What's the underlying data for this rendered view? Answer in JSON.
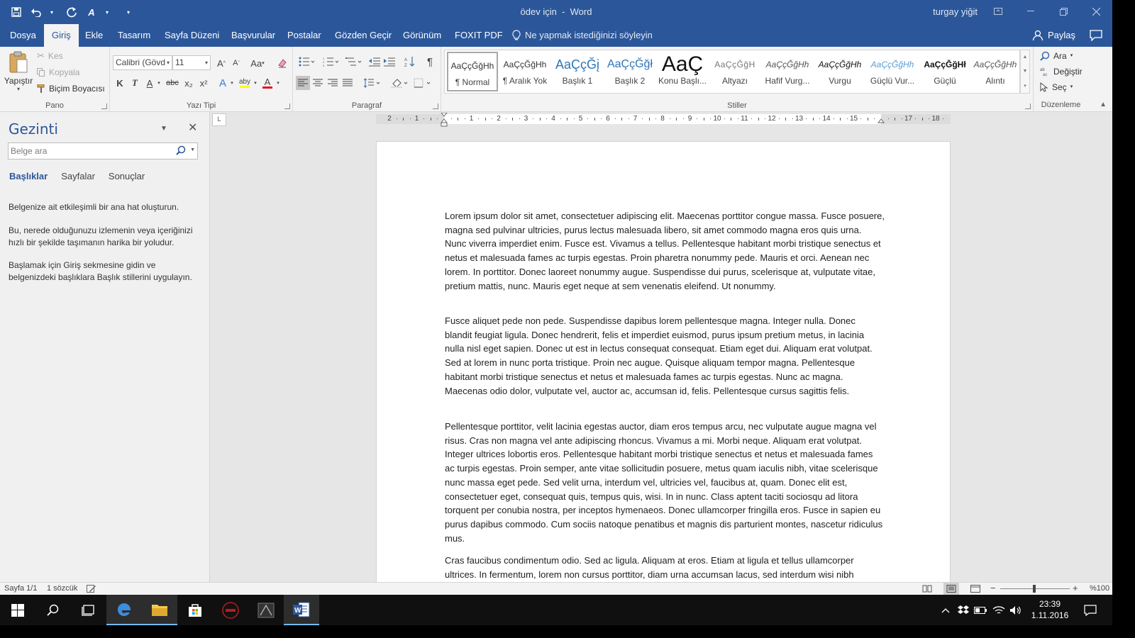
{
  "window": {
    "document_name": "ödev için",
    "separator": "-",
    "app_name": "Word",
    "user_name": "turgay yiğit"
  },
  "quick_access": {
    "icons": [
      "save-icon",
      "undo-icon",
      "redo-icon",
      "spelling-check-icon",
      "customize-icon"
    ]
  },
  "menu_tabs": [
    "Dosya",
    "Giriş",
    "Ekle",
    "Tasarım",
    "Sayfa Düzeni",
    "Başvurular",
    "Postalar",
    "Gözden Geçir",
    "Görünüm",
    "FOXIT PDF"
  ],
  "active_tab": "Giriş",
  "tell_me": "Ne yapmak istediğinizi söyleyin",
  "share_label": "Paylaş",
  "ribbon": {
    "clipboard": {
      "label": "Pano",
      "paste": "Yapıştır",
      "cut": "Kes",
      "copy": "Kopyala",
      "format_painter": "Biçim Boyacısı"
    },
    "font": {
      "label": "Yazı Tipi",
      "font_name": "Calibri (Gövd",
      "font_size": "11",
      "change_case": "Aa",
      "bold": "K",
      "italic": "T",
      "underline": "A",
      "strikethrough": "abc",
      "subscript": "x₂",
      "superscript": "x²",
      "grow": "A",
      "shrink": "A",
      "text_effects": "A",
      "highlight": "aby",
      "font_color": "A",
      "font_color_value": "#e81123",
      "highlight_color_value": "#ffff00"
    },
    "paragraph": {
      "label": "Paragraf"
    },
    "styles": {
      "label": "Stiller",
      "sample": "AaÇçĞğHh",
      "items": [
        {
          "sample": "AaÇçĞğHh",
          "name": "¶ Normal"
        },
        {
          "sample": "AaÇçĞğHh",
          "name": "¶ Aralık Yok"
        },
        {
          "sample": "AaÇçĞį",
          "name": "Başlık 1"
        },
        {
          "sample": "AaÇçĞğł",
          "name": "Başlık 2"
        },
        {
          "sample": "AaÇ",
          "name": "Konu Başlı..."
        },
        {
          "sample": "AaÇçĞğH",
          "name": "Altyazı"
        },
        {
          "sample": "AaÇçĞğHh",
          "name": "Hafif Vurg..."
        },
        {
          "sample": "AaÇçĞğHh",
          "name": "Vurgu"
        },
        {
          "sample": "AaÇçĞğHh",
          "name": "Güçlü Vur..."
        },
        {
          "sample": "AaÇçĞğHł",
          "name": "Güçlü"
        },
        {
          "sample": "AaÇçĞğHh",
          "name": "Alıntı"
        }
      ],
      "selected": "¶ Normal"
    },
    "editing": {
      "label": "Düzenleme",
      "find": "Ara",
      "replace": "Değiştir",
      "select": "Seç"
    }
  },
  "nav_pane": {
    "title": "Gezinti",
    "search_placeholder": "Belge ara",
    "tabs": [
      "Başlıklar",
      "Sayfalar",
      "Sonuçlar"
    ],
    "active_tab": "Başlıklar",
    "help_1": "Belgenize ait etkileşimli bir ana hat oluşturun.",
    "help_2": "Bu, nerede olduğunuzu izlemenin veya içeriğinizi hızlı bir şekilde taşımanın harika bir yoludur.",
    "help_3": "Başlamak için Giriş sekmesine gidin ve belgenizdeki başlıklara Başlık stillerini uygulayın."
  },
  "ruler": {
    "tab_selector": "L",
    "numbers": [
      "2",
      "1",
      "",
      "1",
      "2",
      "3",
      "4",
      "5",
      "6",
      "7",
      "8",
      "9",
      "10",
      "11",
      "12",
      "13",
      "14",
      "15",
      "",
      "17",
      "18"
    ]
  },
  "document": {
    "paragraphs": [
      "Lorem ipsum dolor sit amet, consectetuer adipiscing elit. Maecenas porttitor congue massa. Fusce posuere, magna sed pulvinar ultricies, purus lectus malesuada libero, sit amet commodo magna eros quis urna. Nunc viverra imperdiet enim. Fusce est. Vivamus a tellus. Pellentesque habitant morbi tristique senectus et netus et malesuada fames ac turpis egestas. Proin pharetra nonummy pede. Mauris et orci. Aenean nec lorem. In porttitor. Donec laoreet nonummy augue. Suspendisse dui purus, scelerisque at, vulputate vitae, pretium mattis, nunc. Mauris eget neque at sem venenatis eleifend. Ut nonummy.",
      "Fusce aliquet pede non pede. Suspendisse dapibus lorem pellentesque magna. Integer nulla. Donec blandit feugiat ligula. Donec hendrerit, felis et imperdiet euismod, purus ipsum pretium metus, in lacinia nulla nisl eget sapien. Donec ut est in lectus consequat consequat. Etiam eget dui. Aliquam erat volutpat. Sed at lorem in nunc porta tristique. Proin nec augue. Quisque aliquam tempor magna. Pellentesque habitant morbi tristique senectus et netus et malesuada fames ac turpis egestas. Nunc ac magna. Maecenas odio dolor, vulputate vel, auctor ac, accumsan id, felis. Pellentesque cursus sagittis felis.",
      "Pellentesque porttitor, velit lacinia egestas auctor, diam eros tempus arcu, nec vulputate augue magna vel risus. Cras non magna vel ante adipiscing rhoncus. Vivamus a mi. Morbi neque. Aliquam erat volutpat. Integer ultrices lobortis eros. Pellentesque habitant morbi tristique senectus et netus et malesuada fames ac turpis egestas. Proin semper, ante vitae sollicitudin posuere, metus quam iaculis nibh, vitae scelerisque nunc massa eget pede. Sed velit urna, interdum vel, ultricies vel, faucibus at, quam. Donec elit est, consectetuer eget, consequat quis, tempus quis, wisi. In in nunc. Class aptent taciti sociosqu ad litora torquent per conubia nostra, per inceptos hymenaeos. Donec ullamcorper fringilla eros. Fusce in sapien eu purus dapibus commodo. Cum sociis natoque penatibus et magnis dis parturient montes, nascetur ridiculus mus.",
      "Cras faucibus condimentum odio. Sed ac ligula. Aliquam at eros. Etiam at ligula et tellus ullamcorper ultrices. In fermentum, lorem non cursus porttitor, diam urna accumsan lacus, sed interdum wisi nibh"
    ]
  },
  "status": {
    "page": "Sayfa 1/1",
    "words": "1 sözcük",
    "zoom": "%100",
    "zoom_minus": "−",
    "zoom_plus": "+",
    "zoom_level": 1.0
  },
  "taskbar": {
    "time": "23:39",
    "date": "1.11.2016",
    "apps": [
      "start-icon",
      "search-icon",
      "task-view-icon",
      "edge-icon",
      "file-explorer-icon",
      "store-icon",
      "asus-app-icon",
      "game-app-icon",
      "word-icon"
    ]
  },
  "colors": {
    "word_blue": "#2b579a",
    "ribbon_bg": "#f3f3f3",
    "taskbar_bg": "#101010"
  }
}
